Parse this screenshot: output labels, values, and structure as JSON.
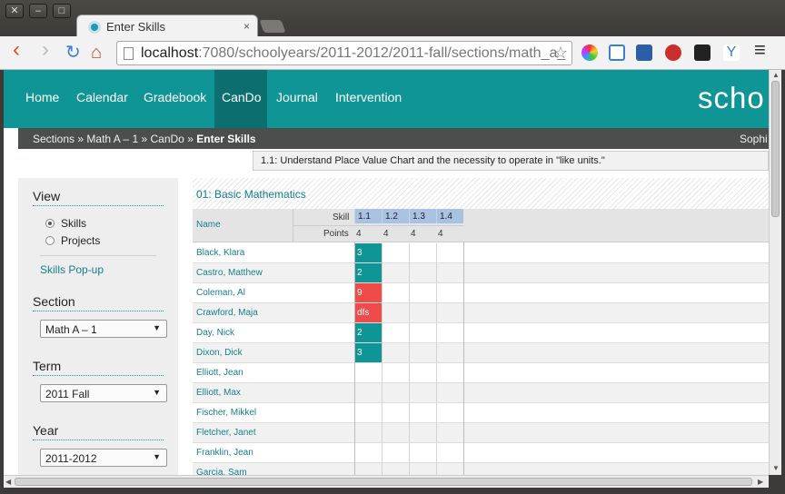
{
  "window": {
    "buttons": [
      "✕",
      "–",
      "□"
    ]
  },
  "tab": {
    "title": "Enter Skills",
    "close": "×"
  },
  "toolbar": {
    "url_host": "localhost",
    "url_rest": ":7080/schoolyears/2011-2012/2011-fall/sections/math_a_",
    "back": "‹",
    "forward": "›",
    "reload": "↻",
    "home": "⌂",
    "star": "☆",
    "menu": "≡"
  },
  "nav": {
    "items": [
      "Home",
      "Calendar",
      "Gradebook",
      "CanDo",
      "Journal",
      "Intervention"
    ],
    "active": "CanDo",
    "brand": "scho"
  },
  "breadcrumb": {
    "sections": "Sections",
    "section": "Math A – 1",
    "cando": "CanDo",
    "current": "Enter Skills",
    "sep": "»",
    "user": "Sophi"
  },
  "tooltip": "1.1: Understand Place Value Chart and the necessity to operate in \"like units.\"",
  "sidebar": {
    "view_title": "View",
    "view_options": [
      {
        "label": "Skills",
        "checked": true
      },
      {
        "label": "Projects",
        "checked": false
      }
    ],
    "popup_link": "Skills Pop-up",
    "section_title": "Section",
    "section_value": "Math A – 1",
    "term_title": "Term",
    "term_value": "2011 Fall",
    "year_title": "Year",
    "year_value": "2011-2012"
  },
  "grid": {
    "title": "01: Basic Mathematics",
    "name_header": "Name",
    "skill_label": "Skill",
    "points_label": "Points",
    "skills": [
      "1.1",
      "1.2",
      "1.3",
      "1.4"
    ],
    "points": [
      "4",
      "4",
      "4",
      "4"
    ],
    "colors": {
      "teal": "#0f9596",
      "red": "#ef4b4b",
      "skill_header": "#a9c2e2"
    },
    "rows": [
      {
        "name": "Black, Klara",
        "score": "3",
        "status": "teal"
      },
      {
        "name": "Castro, Matthew",
        "score": "2",
        "status": "teal"
      },
      {
        "name": "Coleman, Al",
        "score": "9",
        "status": "red"
      },
      {
        "name": "Crawford, Maja",
        "score": "dfs",
        "status": "red"
      },
      {
        "name": "Day, Nick",
        "score": "2",
        "status": "teal"
      },
      {
        "name": "Dixon, Dick",
        "score": "3",
        "status": "teal"
      },
      {
        "name": "Elliott, Jean",
        "score": "",
        "status": ""
      },
      {
        "name": "Elliott, Max",
        "score": "",
        "status": ""
      },
      {
        "name": "Fischer, Mikkel",
        "score": "",
        "status": ""
      },
      {
        "name": "Fletcher, Janet",
        "score": "",
        "status": ""
      },
      {
        "name": "Franklin, Jean",
        "score": "",
        "status": ""
      },
      {
        "name": "Garcia, Sam",
        "score": "",
        "status": ""
      }
    ]
  }
}
